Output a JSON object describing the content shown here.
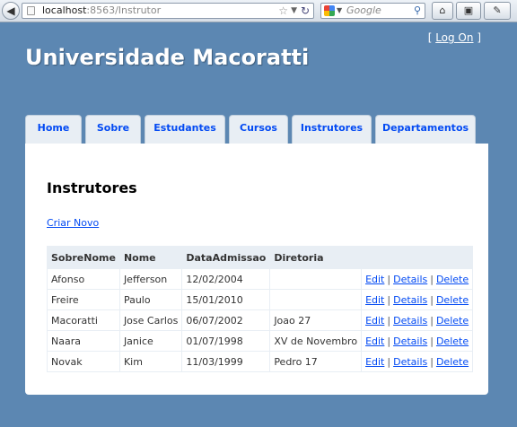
{
  "browser": {
    "back": "◀",
    "url_host": "localhost",
    "url_rest": ":8563/Instrutor",
    "search_placeholder": "Google",
    "home": "⌂",
    "bookmark": "▣",
    "tools": "✎"
  },
  "header": {
    "logon_open": "[ ",
    "logon_link": "Log On",
    "logon_close": " ]",
    "site_title": "Universidade Macoratti"
  },
  "tabs": [
    "Home",
    "Sobre",
    "Estudantes",
    "Cursos",
    "Instrutores",
    "Departamentos"
  ],
  "main": {
    "heading": "Instrutores",
    "new_link": "Criar Novo",
    "columns": [
      "SobreNome",
      "Nome",
      "DataAdmissao",
      "Diretoria",
      ""
    ],
    "action_labels": [
      "Edit",
      "Details",
      "Delete"
    ],
    "action_separator": "|",
    "rows": [
      [
        "Afonso",
        "Jefferson",
        "12/02/2004",
        ""
      ],
      [
        "Freire",
        "Paulo",
        "15/01/2010",
        ""
      ],
      [
        "Macoratti",
        "Jose Carlos",
        "06/07/2002",
        "Joao 27"
      ],
      [
        "Naara",
        "Janice",
        "01/07/1998",
        "XV de Novembro"
      ],
      [
        "Novak",
        "Kim",
        "11/03/1999",
        "Pedro 17"
      ]
    ]
  },
  "colors": {
    "page_background": "#5c87b2",
    "tab_background": "#e8eef4",
    "link": "#034af3"
  }
}
